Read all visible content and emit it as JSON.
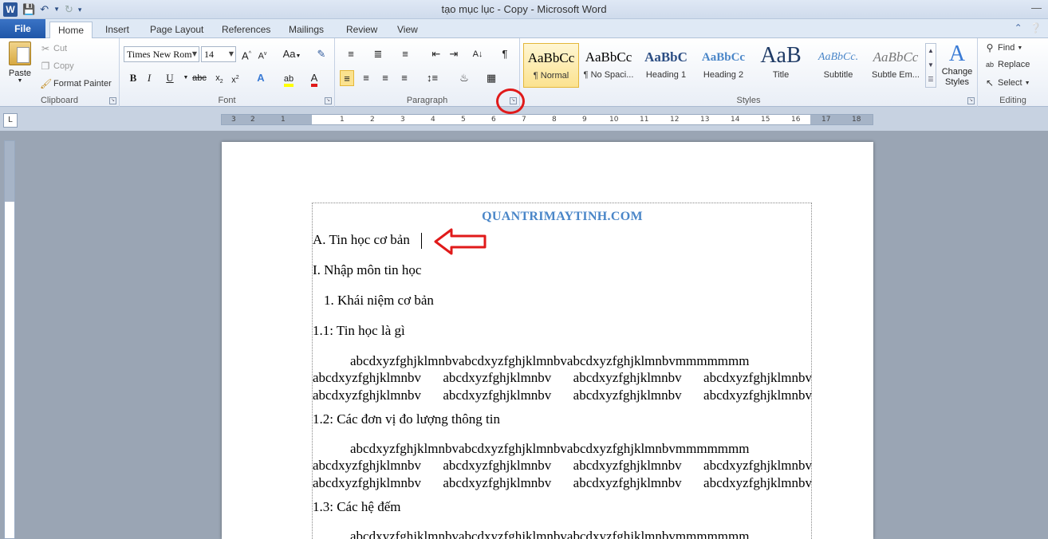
{
  "window": {
    "title": "tạo mục lục - Copy  -  Microsoft Word"
  },
  "tabs": [
    {
      "label": "File"
    },
    {
      "label": "Home"
    },
    {
      "label": "Insert"
    },
    {
      "label": "Page Layout"
    },
    {
      "label": "References"
    },
    {
      "label": "Mailings"
    },
    {
      "label": "Review"
    },
    {
      "label": "View"
    }
  ],
  "clipboard": {
    "paste": "Paste",
    "cut": "Cut",
    "copy": "Copy",
    "format_painter": "Format Painter",
    "label": "Clipboard"
  },
  "font": {
    "name": "Times New Rom",
    "size": "14",
    "label": "Font"
  },
  "paragraph": {
    "label": "Paragraph"
  },
  "styles": {
    "label": "Styles",
    "items": [
      {
        "sample": "AaBbCc",
        "name": "¶ Normal"
      },
      {
        "sample": "AaBbCc",
        "name": "¶ No Spaci..."
      },
      {
        "sample": "AaBbC",
        "name": "Heading 1"
      },
      {
        "sample": "AaBbCc",
        "name": "Heading 2"
      },
      {
        "sample": "AaB",
        "name": "Title"
      },
      {
        "sample": "AaBbCc.",
        "name": "Subtitle"
      },
      {
        "sample": "AaBbCc",
        "name": "Subtle Em..."
      }
    ],
    "change_styles": "Change Styles"
  },
  "editing": {
    "label": "Editing",
    "find": "Find",
    "replace": "Replace",
    "select": "Select"
  },
  "ruler": {
    "ticks": [
      "3",
      "2",
      "1",
      "1",
      "2",
      "3",
      "4",
      "5",
      "6",
      "7",
      "8",
      "9",
      "10",
      "11",
      "12",
      "13",
      "14",
      "15",
      "16",
      "17",
      "18"
    ]
  },
  "document": {
    "header": "QUANTRIMAYTINH.COM",
    "lines": [
      "A. Tin học cơ bản",
      "I. Nhập môn tin học",
      "1. Khái niệm cơ bản",
      "1.1: Tin học là gì",
      "1.2: Các đơn vị đo lượng thông tin",
      "1.3: Các hệ đếm"
    ],
    "para_first": "abcdxyzfghjklmnbvabcdxyzfghjklmnbvabcdxyzfghjklmnbvmmmmmmm",
    "para_rest": "abcdxyzfghjklmnbv abcdxyzfghjklmnbv abcdxyzfghjklmnbv abcdxyzfghjklmnbv"
  },
  "colors": {
    "accent": "#2b579a",
    "header_text": "#4a86c8",
    "annotation": "#e01a1a"
  }
}
